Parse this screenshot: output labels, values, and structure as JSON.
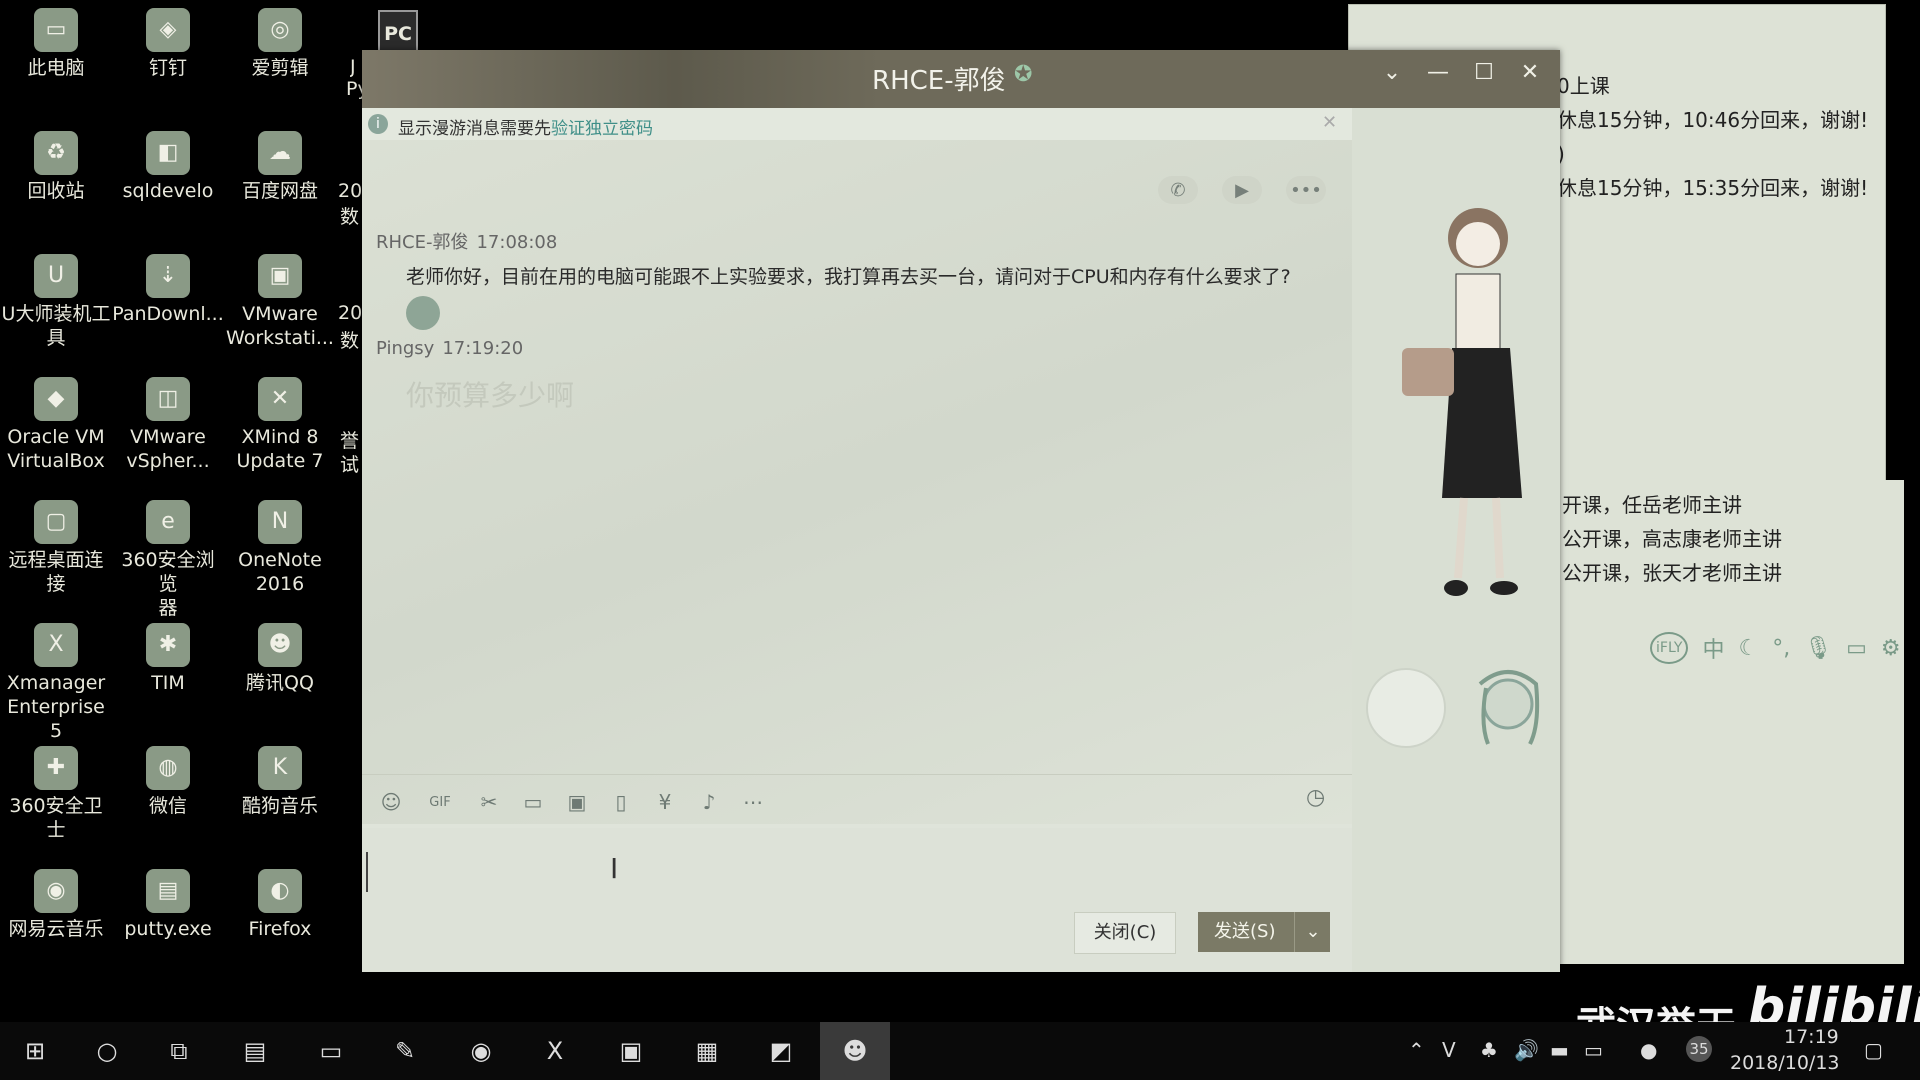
{
  "desktop": {
    "icons": [
      {
        "label1": "此电脑",
        "label2": "",
        "icon": "computer-icon"
      },
      {
        "label1": "钉钉",
        "label2": "",
        "icon": "dingtalk-icon"
      },
      {
        "label1": "爱剪辑",
        "label2": "",
        "icon": "video-editor-icon"
      },
      {
        "label1": "回收站",
        "label2": "",
        "icon": "recycle-bin-icon"
      },
      {
        "label1": "sqldevelo",
        "label2": "",
        "icon": "database-icon"
      },
      {
        "label1": "百度网盘",
        "label2": "",
        "icon": "cloud-drive-icon"
      },
      {
        "label1": "U大师装机工",
        "label2": "具",
        "icon": "usb-tool-icon"
      },
      {
        "label1": "PanDownl...",
        "label2": "",
        "icon": "download-icon"
      },
      {
        "label1": "VMware",
        "label2": "Workstati...",
        "icon": "vmware-icon"
      },
      {
        "label1": "Oracle VM",
        "label2": "VirtualBox",
        "icon": "virtualbox-icon"
      },
      {
        "label1": "VMware",
        "label2": "vSpher...",
        "icon": "vsphere-icon"
      },
      {
        "label1": "XMind 8",
        "label2": "Update 7",
        "icon": "xmind-icon"
      },
      {
        "label1": "远程桌面连接",
        "label2": "",
        "icon": "remote-desktop-icon"
      },
      {
        "label1": "360安全浏览",
        "label2": "器",
        "icon": "browser-icon"
      },
      {
        "label1": "OneNote",
        "label2": "2016",
        "icon": "onenote-icon"
      },
      {
        "label1": "Xmanager",
        "label2": "Enterprise 5",
        "icon": "xmanager-icon"
      },
      {
        "label1": "TIM",
        "label2": "",
        "icon": "tim-icon"
      },
      {
        "label1": "腾讯QQ",
        "label2": "",
        "icon": "qq-icon"
      },
      {
        "label1": "360安全卫士",
        "label2": "",
        "icon": "security-icon"
      },
      {
        "label1": "微信",
        "label2": "",
        "icon": "wechat-icon"
      },
      {
        "label1": "酷狗音乐",
        "label2": "",
        "icon": "kugou-icon"
      },
      {
        "label1": "网易云音乐",
        "label2": "",
        "icon": "netease-music-icon"
      },
      {
        "label1": "putty.exe",
        "label2": "",
        "icon": "putty-icon"
      },
      {
        "label1": "Firefox",
        "label2": "",
        "icon": "firefox-icon"
      }
    ],
    "partial_labels": [
      "J",
      "Py",
      "20",
      "数",
      "20",
      "数",
      "誉",
      "试"
    ],
    "pc_icon_text": "PC"
  },
  "notes": {
    "lines_top": [
      "0上课",
      "休息15分钟，10:46分回来，谢谢!",
      ")",
      "休息15分钟，15:35分回来，谢谢!"
    ],
    "lines_bottom": [
      "开课，任岳老师主讲",
      "公开课，高志康老师主讲",
      "公开课，张天才老师主讲"
    ],
    "ifly_label": "iFLY",
    "ime_lang": "中"
  },
  "chat": {
    "title": "RHCE-郭俊",
    "notice_text": "显示漫游消息需要先",
    "notice_link": "验证独立密码",
    "messages": [
      {
        "sender": "RHCE-郭俊",
        "time": "17:08:08",
        "text": "老师你好，目前在用的电脑可能跟不上实验要求，我打算再去买一台，请问对于CPU和内存有什么要求了?"
      },
      {
        "sender": "Pingsy",
        "time": "17:19:20",
        "text": "你预算多少啊"
      }
    ],
    "close_button": "关闭(C)",
    "send_button": "发送(S)"
  },
  "taskbar": {
    "date": "2018/10/13",
    "time": "17:19",
    "badge": "35"
  },
  "watermark": {
    "text1": "武汉誉天",
    "text2": "bilibili"
  }
}
